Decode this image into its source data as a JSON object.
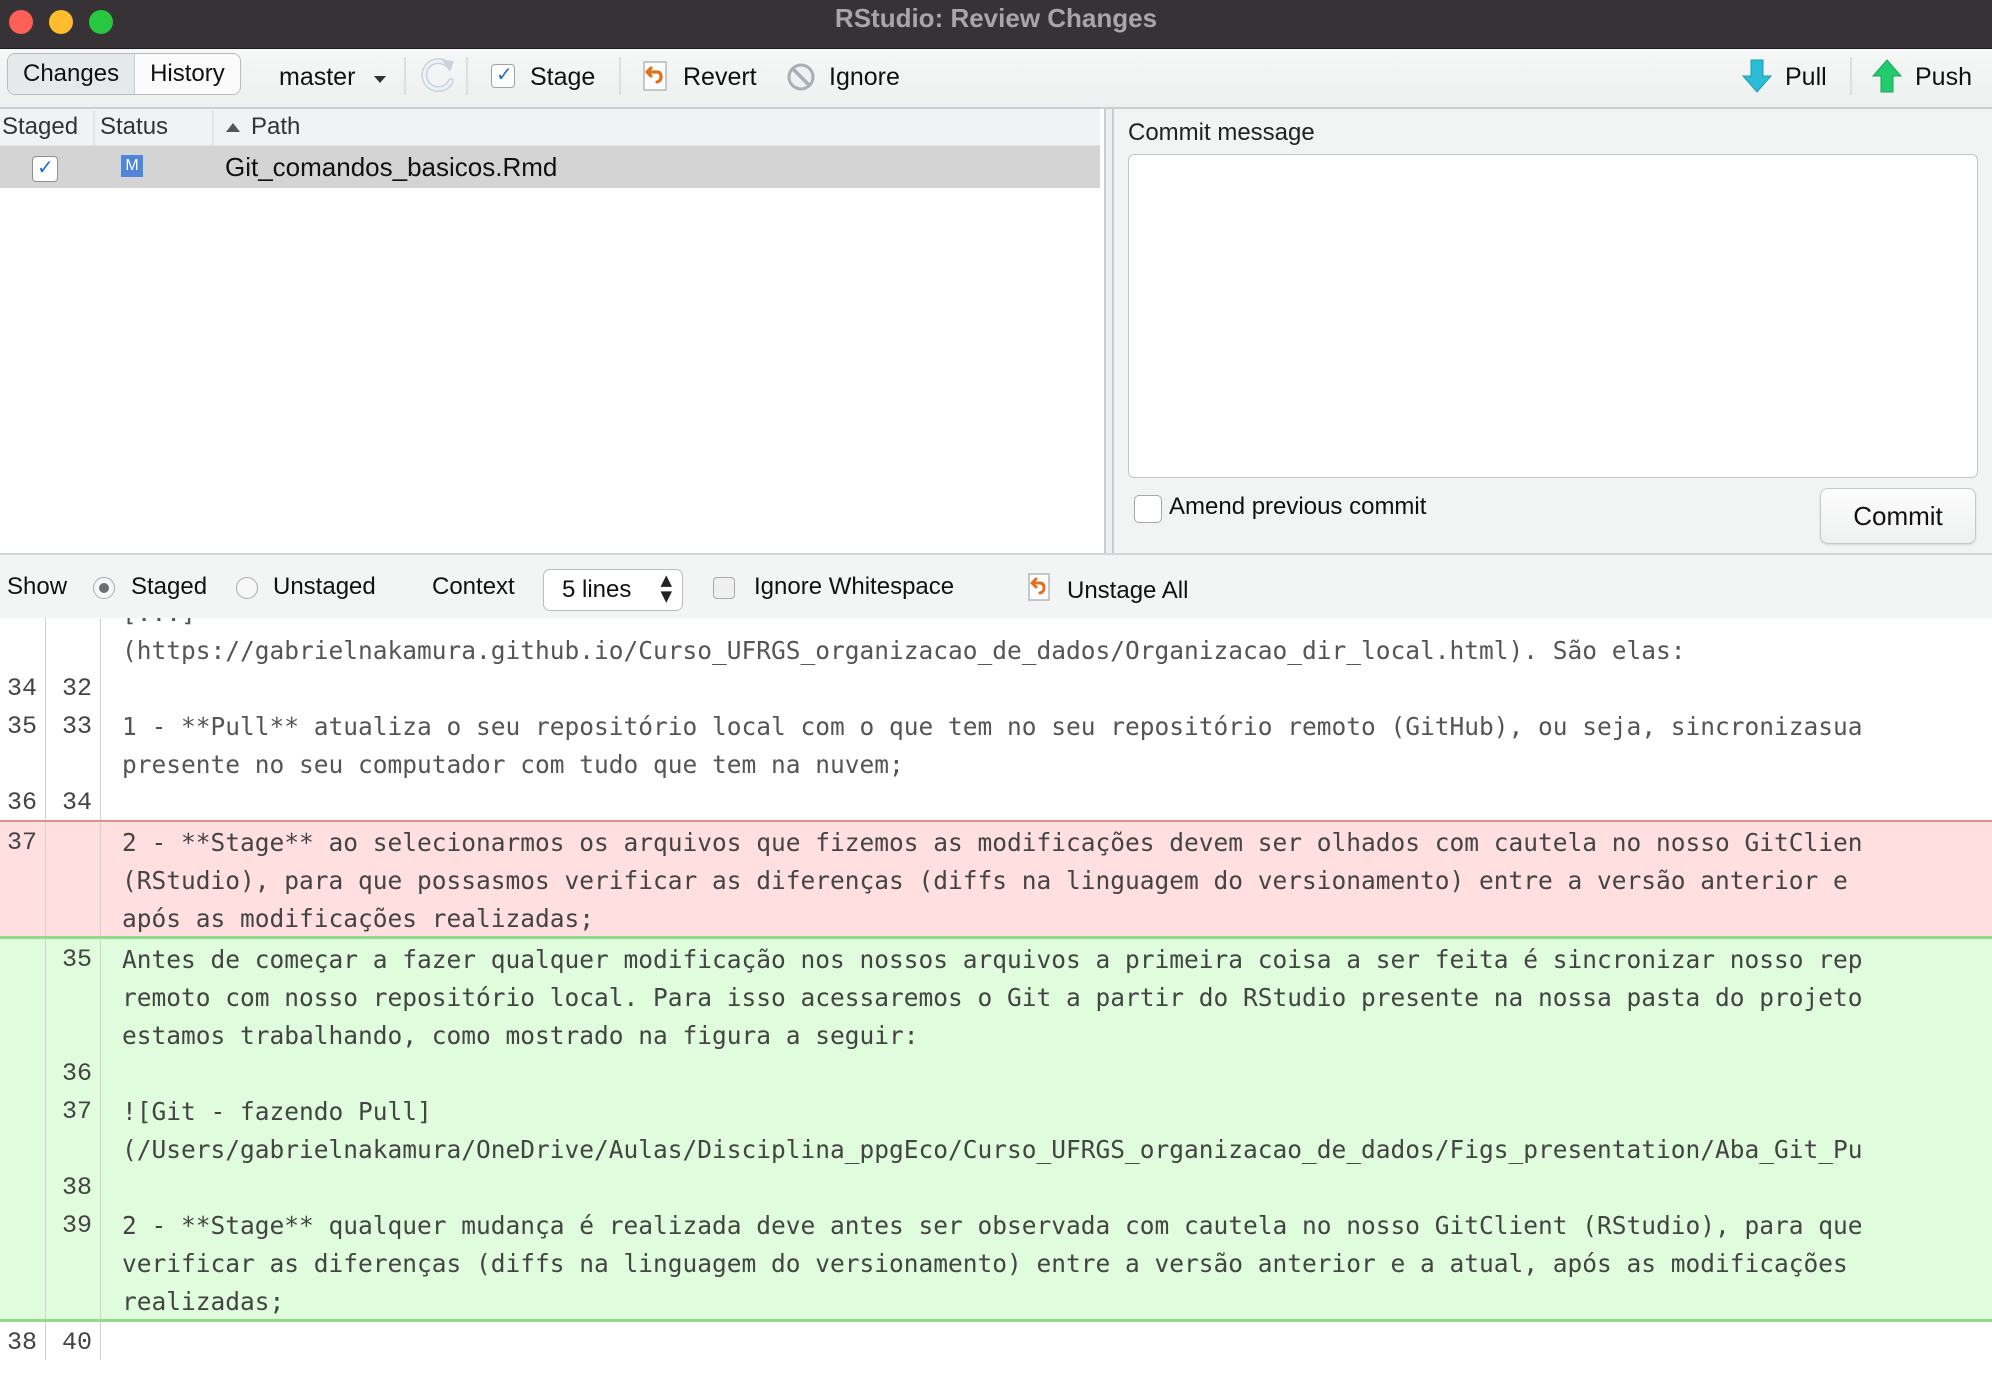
{
  "window": {
    "title": "RStudio: Review Changes"
  },
  "toolbar": {
    "tabs": [
      {
        "label": "Changes",
        "active": true
      },
      {
        "label": "History",
        "active": false
      }
    ],
    "branch": "master",
    "stage_label": "Stage",
    "stage_checked": true,
    "revert_label": "Revert",
    "ignore_label": "Ignore",
    "pull_label": "Pull",
    "push_label": "Push",
    "icons": {
      "branch_dropdown": "caret-down-icon",
      "refresh": "refresh-icon",
      "revert": "revert-icon",
      "ignore": "ignore-icon",
      "pull": "pull-arrow-down-icon",
      "push": "push-arrow-up-icon"
    },
    "colors": {
      "pull_arrow": "#29b6d4",
      "push_arrow": "#1fc76a",
      "revert_icon": "#e0701e"
    }
  },
  "file_list": {
    "columns": [
      "Staged",
      "Status",
      "Path"
    ],
    "sort_column": "Path",
    "sort_direction": "ascending",
    "rows": [
      {
        "staged": true,
        "status": "M",
        "path": "Git_comandos_basicos.Rmd",
        "selected": true
      }
    ]
  },
  "commit": {
    "label": "Commit message",
    "message": "",
    "amend_label": "Amend previous commit",
    "amend_checked": false,
    "button_label": "Commit"
  },
  "diff_options": {
    "show_label": "Show",
    "staged_label": "Staged",
    "unstaged_label": "Unstaged",
    "show_selected": "Staged",
    "context_label": "Context",
    "context_value": "5 lines",
    "ignore_ws_label": "Ignore Whitespace",
    "ignore_ws_checked": false,
    "unstage_all_label": "Unstage All"
  },
  "diff": {
    "colors": {
      "deleted_bg": "#ffdfdf",
      "added_bg": "#dffcdc"
    },
    "lines": [
      {
        "type": "context",
        "old": "",
        "new": "",
        "text": [
          "[...]",
          "(https://gabrielnakamura.github.io/Curso_UFRGS_organizacao_de_dados/Organizacao_dir_local.html). São elas:"
        ]
      },
      {
        "type": "context",
        "old": "34",
        "new": "32",
        "text": [
          ""
        ]
      },
      {
        "type": "context",
        "old": "35",
        "new": "33",
        "text": [
          "1 - **Pull** atualiza o seu repositório local com o que tem no seu repositório remoto (GitHub), ou seja, sincronizasua",
          "presente no seu computador com tudo que tem na nuvem;"
        ]
      },
      {
        "type": "context",
        "old": "36",
        "new": "34",
        "text": [
          ""
        ]
      },
      {
        "type": "deleted",
        "old": "37",
        "new": "",
        "text": [
          "2 - **Stage** ao selecionarmos os arquivos que fizemos as modificações devem ser olhados com cautela no nosso GitClien",
          "(RStudio), para que possasmos verificar as diferenças (diffs na linguagem do versionamento) entre a versão anterior e",
          "após as modificações realizadas;"
        ]
      },
      {
        "type": "added",
        "old": "",
        "new": "35",
        "text": [
          "Antes de começar a fazer qualquer modificação nos nossos arquivos a primeira coisa a ser feita é sincronizar nosso rep",
          "remoto com nosso repositório local. Para isso acessaremos o Git a partir do RStudio presente na nossa pasta do projeto",
          "estamos trabalhando, como mostrado na figura a seguir:"
        ]
      },
      {
        "type": "added",
        "old": "",
        "new": "36",
        "text": [
          ""
        ]
      },
      {
        "type": "added",
        "old": "",
        "new": "37",
        "text": [
          "![Git - fazendo Pull]",
          "(/Users/gabrielnakamura/OneDrive/Aulas/Disciplina_ppgEco/Curso_UFRGS_organizacao_de_dados/Figs_presentation/Aba_Git_Pu"
        ]
      },
      {
        "type": "added",
        "old": "",
        "new": "38",
        "text": [
          ""
        ]
      },
      {
        "type": "added",
        "old": "",
        "new": "39",
        "text": [
          "2 - **Stage** qualquer mudança é realizada deve antes ser observada com cautela no nosso GitClient (RStudio), para que",
          "verificar as diferenças (diffs na linguagem do versionamento) entre a versão anterior e a atual, após as modificações",
          "realizadas;"
        ]
      },
      {
        "type": "context",
        "old": "38",
        "new": "40",
        "text": [
          ""
        ]
      }
    ]
  }
}
